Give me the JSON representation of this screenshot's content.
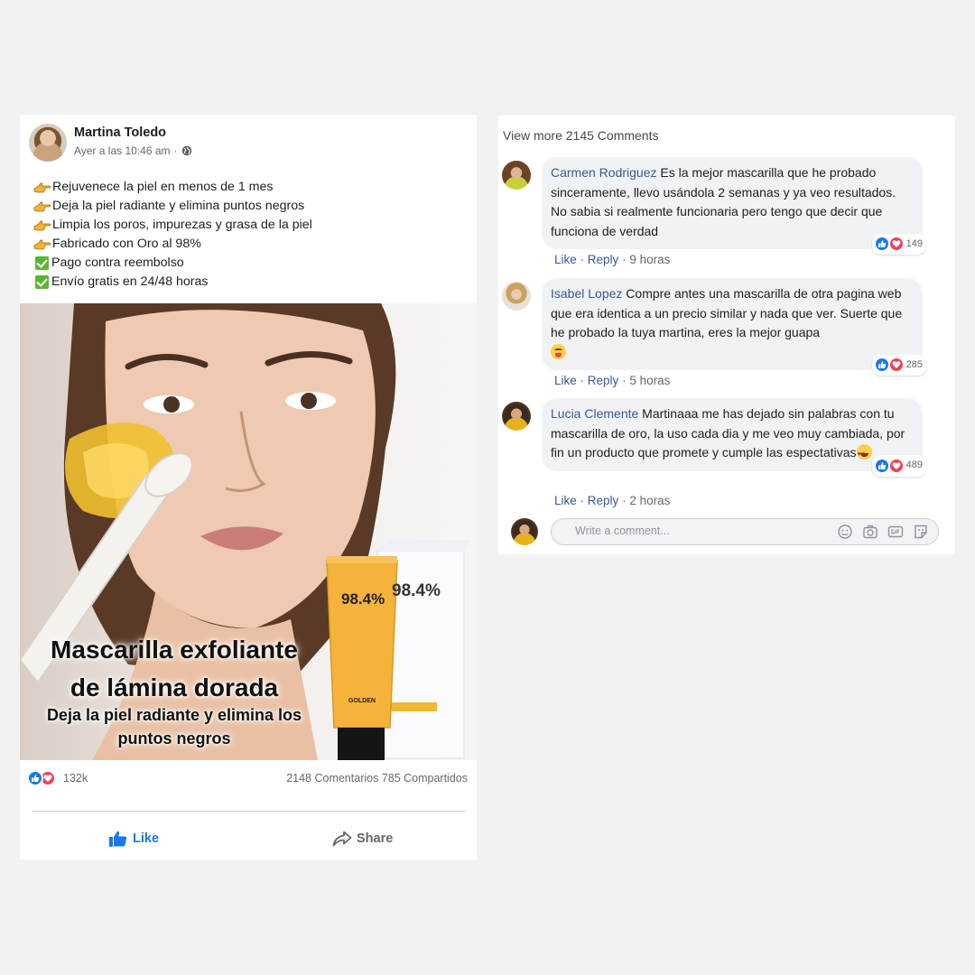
{
  "post": {
    "author": "Martina Toledo",
    "timestamp": "Ayer a las 10:46 am",
    "privacy_separator": "·",
    "privacy_icon": "globe-icon",
    "body_lines": [
      {
        "icon": "pointing-hand-icon",
        "text": "Rejuvenece la piel en menos de 1 mes"
      },
      {
        "icon": "pointing-hand-icon",
        "text": "Deja la piel radiante y elimina puntos negros"
      },
      {
        "icon": "pointing-hand-icon",
        "text": "Limpia los poros, impurezas y grasa de la piel"
      },
      {
        "icon": "pointing-hand-icon",
        "text": "Fabricado con Oro al 98%"
      },
      {
        "icon": "check-mark-icon",
        "text": "Pago contra reembolso"
      },
      {
        "icon": "check-mark-icon",
        "text": "Envío gratis en 24/48 horas"
      }
    ],
    "ad_image": {
      "title_line1": "Mascarilla exfoliante",
      "title_line2": "de lámina dorada",
      "subtitle_line1": "Deja la piel radiante y elimina los",
      "subtitle_line2": "puntos negros",
      "product_label_percent": "98.4%",
      "product_label_name": "GOLDEN"
    },
    "reaction_count": "132k",
    "comments_shares": "2148 Comentarios 785 Compartidos",
    "like_label": "Like",
    "share_label": "Share"
  },
  "comments_panel": {
    "view_more": "View more 2145 Comments",
    "comments": [
      {
        "name": "Carmen Rodriguez",
        "text": "Es la mejor mascarilla que he probado sinceramente, llevo usándola 2 semanas y ya veo resultados. No sabia si realmente funcionaria pero tengo que decir que funciona de verdad",
        "reactions": "149",
        "like": "Like",
        "reply": "Reply",
        "time": "9 horas"
      },
      {
        "name": "Isabel Lopez",
        "text": "Compre antes una mascarilla de otra pagina web que era identica a un precio similar y nada que ver. Suerte que he probado la tuya martina, eres la mejor guapa",
        "reactions": "285",
        "like": "Like",
        "reply": "Reply",
        "time": "5 horas"
      },
      {
        "name": "Lucia Clemente",
        "text": "Martinaaa me has dejado sin palabras con tu mascarilla de oro, la uso cada dia y me veo muy cambiada, por fin un producto que promete y cumple las espectativas",
        "reactions": "489",
        "like": "Like",
        "reply": "Reply",
        "time": "2 horas"
      }
    ],
    "write_placeholder": "Write a comment..."
  },
  "colors": {
    "accent": "#1877f2",
    "love": "#f33e58",
    "link": "#385898",
    "bubble": "#f0f2f5"
  }
}
